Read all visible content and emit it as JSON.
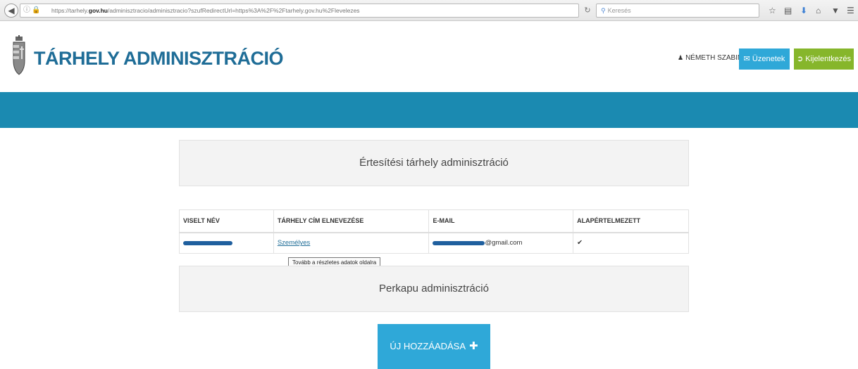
{
  "browser": {
    "url_prefix": "https://tarhely.",
    "url_domain": "gov.hu",
    "url_suffix": "/adminisztracio/adminisztracio?szufRedirectUrl=https%3A%2F%2Ftarhely.gov.hu%2Flevelezes",
    "search_placeholder": "Keresés"
  },
  "header": {
    "title": "TÁRHELY ADMINISZTRÁCIÓ",
    "user_name": "NÉMETH SZABINA",
    "messages_button": "Üzenetek",
    "logout_button": "Kijelentkezés"
  },
  "notice_panel": {
    "title": "Értesítési tárhely adminisztráció"
  },
  "table": {
    "headers": [
      "VISELT NÉV",
      "TÁRHELY CÍM ELNEVEZÉSE",
      "E-MAIL",
      "ALAPÉRTELMEZETT"
    ],
    "rows": [
      {
        "name": "",
        "address_name": "Személyes",
        "email": "@gmail.com",
        "default": "✔"
      }
    ]
  },
  "tooltip": "Tovább a részletes adatok oldalra",
  "perkapu_panel": {
    "title": "Perkapu adminisztráció"
  },
  "add_button": "ÚJ HOZZÁADÁSA",
  "colors": {
    "brand_blue": "#1f6d97",
    "band_blue": "#1b8ab1",
    "button_blue": "#2fa8d8",
    "button_green": "#86b62b"
  }
}
